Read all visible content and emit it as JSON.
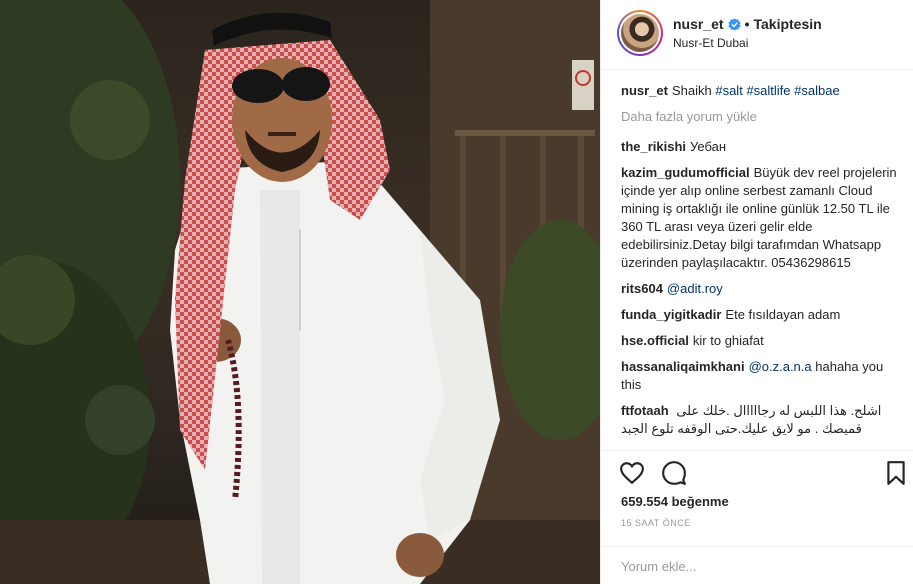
{
  "post": {
    "username": "nusr_et",
    "follow_separator": "•",
    "follow_label": "Takiptesin",
    "location": "Nusr-Et Dubai"
  },
  "caption": {
    "username": "nusr_et",
    "text": "Shaikh",
    "tags": [
      "#salt",
      "#saltlife",
      "#salbae"
    ]
  },
  "load_more": "Daha fazla yorum yükle",
  "comments": [
    {
      "user": "the_rikishi",
      "text": "Уебан"
    },
    {
      "user": "kazim_gudumofficial",
      "text": "Büyük dev reel projelerin içinde yer alıp online serbest zamanlı Cloud mining iş ortaklığı ile online günlük 12.50 TL ile 360 TL arası veya üzeri gelir elde edebilirsiniz.Detay bilgi tarafımdan Whatsapp üzerinden paylaşılacaktır. 05436298615"
    },
    {
      "user": "rits604",
      "mention": "@adit.roy",
      "text": ""
    },
    {
      "user": "funda_yigitkadir",
      "text": "Ete fısıldayan adam"
    },
    {
      "user": "hse.official",
      "text": "kir to ghiafat"
    },
    {
      "user": "hassanaliqaimkhani",
      "mention": "@o.z.a.n.a",
      "text": "hahaha you this"
    },
    {
      "user": "ftfotaah",
      "text": "اشلح. هذا اللبس له رجااااال .خلك على قميصك . مو لايق عليك.حتى الوقفه تلوع الجبد"
    }
  ],
  "likes": "659.554 beğenme",
  "time": "15 SAAT ÖNCE",
  "comment_placeholder": "Yorum ekle...",
  "icons": [
    "heart-icon",
    "comment-icon",
    "bookmark-icon",
    "verified-badge-icon"
  ],
  "colors": {
    "verified": "#3897f0",
    "tag": "#003569",
    "muted": "#999999"
  }
}
